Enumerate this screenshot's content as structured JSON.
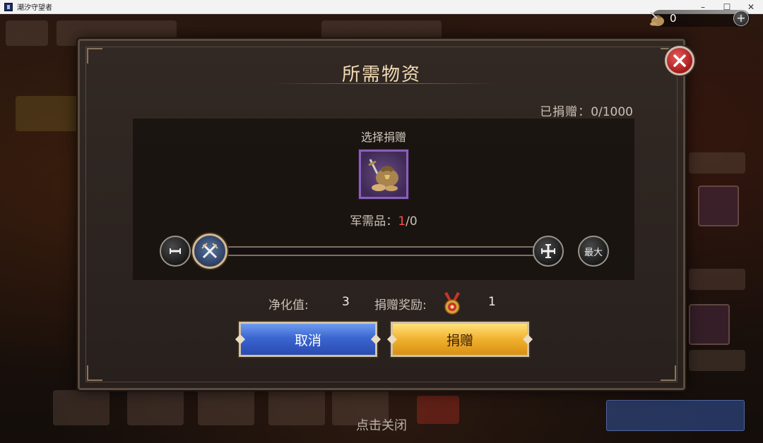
{
  "window": {
    "title": "潮汐守望者",
    "controls": [
      "–",
      "☐",
      "✕"
    ]
  },
  "currency": {
    "value": "0",
    "plus_label": "+",
    "icon": "supply-bag-icon"
  },
  "dialog": {
    "title": "所需物资",
    "donated_label": "已捐赠：",
    "donated_value": "0/1000",
    "select_label": "选择捐赠",
    "item_icon": "supply-bag-sword-icon",
    "supply_label": "军需品：",
    "supply_selected": "1",
    "supply_rest": "/0",
    "slider": {
      "minus_label": "−",
      "plus_label": "+",
      "max_label": "最大",
      "value": 0.0
    },
    "purify_label": "净化值:",
    "purify_value": "3",
    "reward_label": "捐赠奖励:",
    "reward_icon": "medal-icon",
    "reward_value": "1",
    "cancel_label": "取消",
    "donate_label": "捐赠"
  },
  "footer": {
    "tap_close": "点击关闭"
  },
  "colors": {
    "title": "#f2dcb4",
    "highlight_red": "#ff4b4b",
    "cancel_blue": "#3b66d1",
    "donate_gold": "#f0b12e"
  }
}
